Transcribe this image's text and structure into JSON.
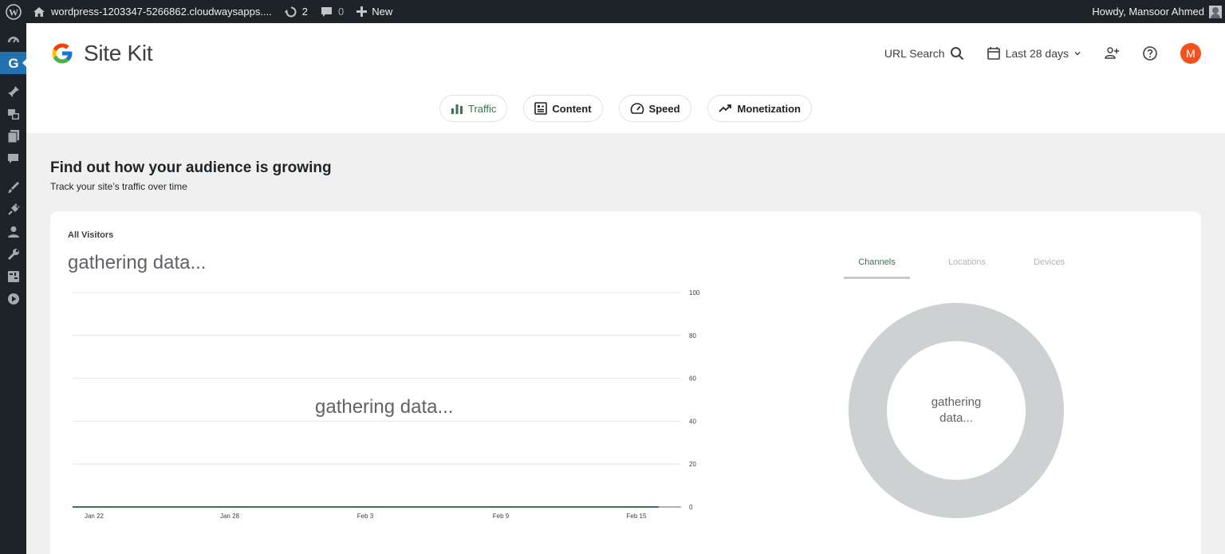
{
  "adminbar": {
    "site_url": "wordpress-1203347-5266862.cloudwaysapps....",
    "updates_count": "2",
    "comments_count": "0",
    "new_label": "New",
    "greeting": "Howdy, Mansoor Ahmed"
  },
  "sidebar": {
    "items": [
      "dashboard-icon",
      "site-kit-icon",
      "posts-icon",
      "media-icon",
      "pages-icon",
      "comments-icon",
      "appearance-icon",
      "plugins-icon",
      "users-icon",
      "tools-icon",
      "settings-icon",
      "play-icon"
    ]
  },
  "header": {
    "logo_text": "Site Kit",
    "url_search_label": "URL Search",
    "date_range_label": "Last 28 days",
    "avatar_initial": "M"
  },
  "tabs": [
    {
      "label": "Traffic",
      "icon": "bar-chart-icon",
      "active": true
    },
    {
      "label": "Content",
      "icon": "content-icon",
      "active": false
    },
    {
      "label": "Speed",
      "icon": "speedometer-icon",
      "active": false
    },
    {
      "label": "Monetization",
      "icon": "trending-up-icon",
      "active": false
    }
  ],
  "section": {
    "title": "Find out how your audience is growing",
    "subtitle": "Track your site’s traffic over time"
  },
  "card": {
    "label": "All Visitors",
    "status_text": "gathering data...",
    "chart_overlay_text": "gathering data...",
    "ring_tabs": [
      "Channels",
      "Locations",
      "Devices"
    ],
    "ring_center_text": "gathering data..."
  },
  "chart_data": {
    "type": "line",
    "x": [
      "Jan 22",
      "Jan 28",
      "Feb 3",
      "Feb 9",
      "Feb 15"
    ],
    "y_ticks": [
      0,
      20,
      40,
      60,
      80,
      100
    ],
    "ylim": [
      0,
      100
    ],
    "series": [
      {
        "values": [
          0,
          0,
          0,
          0,
          0
        ]
      }
    ],
    "grid": true,
    "colors": {
      "line": "#3c7251",
      "grid": "#e6e6e6"
    }
  }
}
